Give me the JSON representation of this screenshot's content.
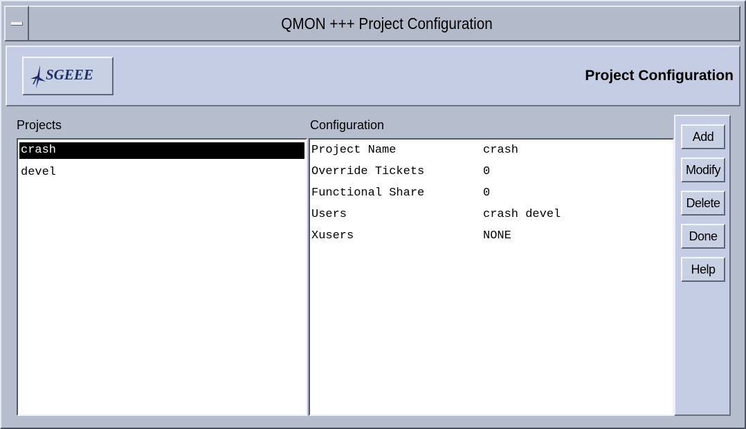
{
  "window": {
    "title": "QMON +++ Project Configuration"
  },
  "header": {
    "logo_text": "SGEEE",
    "title": "Project Configuration"
  },
  "projects": {
    "label": "Projects",
    "items": [
      {
        "name": "crash",
        "selected": true
      },
      {
        "name": "devel",
        "selected": false
      }
    ]
  },
  "configuration": {
    "label": "Configuration",
    "rows": [
      {
        "key": "Project Name",
        "value": "crash"
      },
      {
        "key": "Override Tickets",
        "value": "0"
      },
      {
        "key": "Functional Share",
        "value": "0"
      },
      {
        "key": "Users",
        "value": "crash devel"
      },
      {
        "key": "Xusers",
        "value": "NONE"
      }
    ]
  },
  "buttons": {
    "add": "Add",
    "modify": "Modify",
    "delete": "Delete",
    "done": "Done",
    "help": "Help"
  },
  "colors": {
    "window_bg": "#b6becd",
    "panel_bg": "#c4cde4",
    "selection": "#000000",
    "logo_text": "#1f2f6a"
  }
}
